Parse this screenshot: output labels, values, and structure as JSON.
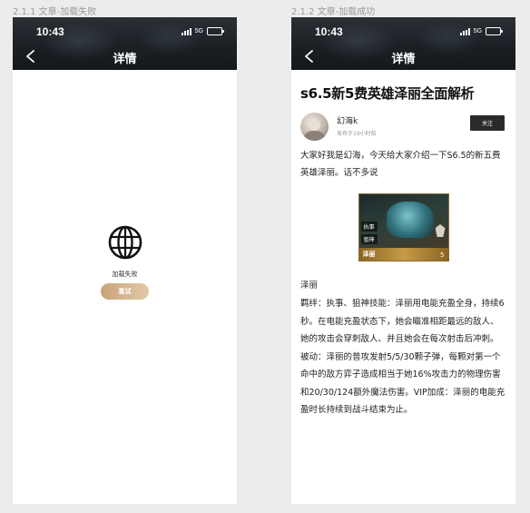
{
  "frames": [
    {
      "caption": "2.1.1 文章-加载失败",
      "status": {
        "time": "10:43",
        "network": "5G"
      },
      "nav_title": "详情",
      "fail": {
        "message": "加载失败",
        "retry_label": "重试"
      }
    },
    {
      "caption": "2.1.2 文章-加载成功",
      "status": {
        "time": "10:43",
        "network": "5G"
      },
      "nav_title": "详情",
      "article": {
        "title": "s6.5新5费英雄泽丽全面解析",
        "author": {
          "name": "幻海k",
          "time": "发布于19小时前",
          "follow_label": "关注"
        },
        "intro": "大家好我是幻海，今天给大家介绍一下S6.5的新五费英雄泽丽。话不多说",
        "image": {
          "trait_1": "执事",
          "trait_2": "狙神",
          "hero_name": "泽丽",
          "cost": "5"
        },
        "section_heading": "泽丽",
        "body": "羁绊：执事、狙神技能：泽丽用电能充盈全身，持续6秒。在电能充盈状态下，她会瞄准相距最远的敌人、她的攻击会穿刺敌人、并且她会在每次射击后冲刺。 被动：泽丽的普攻发射5/5/30颗子弹，每颗对第一个命中的敌方弈子造成相当于她16%攻击力的物理伤害和20/30/124额外魔法伤害。VIP加成：泽丽的电能充盈时长持续到战斗结束为止。"
      }
    }
  ]
}
